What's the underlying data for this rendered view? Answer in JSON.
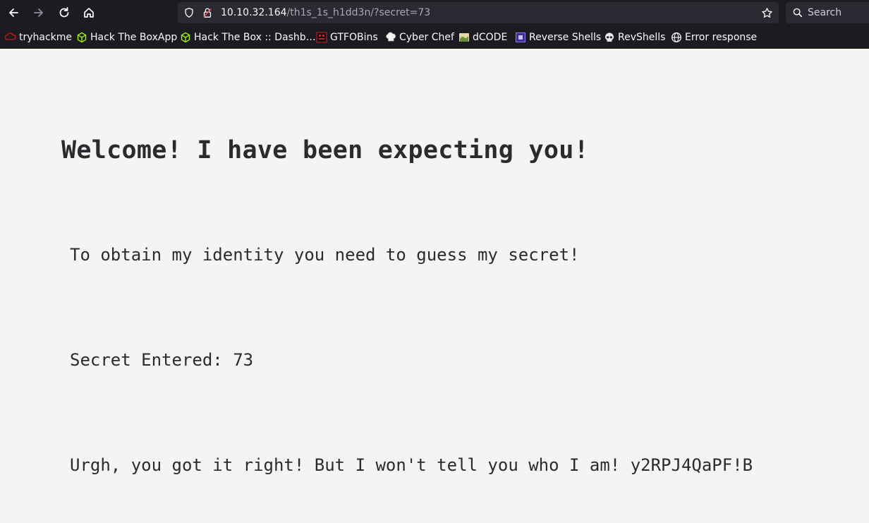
{
  "browser": {
    "url": {
      "host": "10.10.32.164",
      "path": "/th1s_1s_h1dd3n/?secret=73"
    },
    "search_placeholder": "Search",
    "bookmarks": [
      {
        "label": "tryhackme",
        "icon": "tryhackme-icon"
      },
      {
        "label": "Hack The BoxApp",
        "icon": "hackthebox-icon"
      },
      {
        "label": "Hack The Box :: Dashb…",
        "icon": "hackthebox-icon"
      },
      {
        "label": "GTFOBins",
        "icon": "gtfobins-icon"
      },
      {
        "label": "Cyber Chef",
        "icon": "chef-hat-icon"
      },
      {
        "label": "dCODE",
        "icon": "dcode-icon"
      },
      {
        "label": "Reverse Shells",
        "icon": "reverse-shells-icon"
      },
      {
        "label": "RevShells",
        "icon": "skull-icon"
      },
      {
        "label": "Error response",
        "icon": "globe-icon"
      }
    ]
  },
  "page": {
    "heading": "Welcome! I have been expecting you!",
    "intro": "To obtain my identity you need to guess my secret!",
    "secret_entered": "Secret Entered: 73",
    "result": "Urgh, you got it right! But I won't tell you who I am! y2RPJ4QaPF!B"
  }
}
